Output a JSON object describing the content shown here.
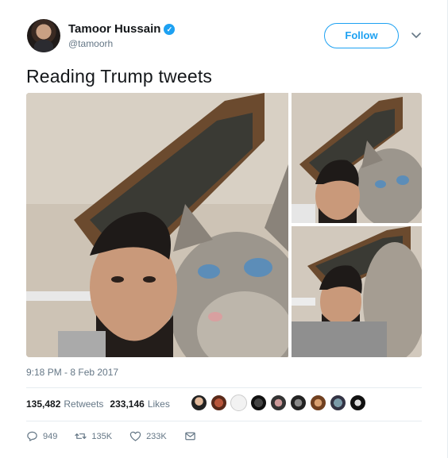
{
  "author": {
    "name": "Tamoor Hussain",
    "handle": "@tamoorh",
    "verified_mark": "✓"
  },
  "follow_label": "Follow",
  "tweet_text": "Reading Trump tweets",
  "timestamp": "9:18 PM - 8 Feb 2017",
  "stats": {
    "retweets_count": "135,482",
    "retweets_label": "Retweets",
    "likes_count": "233,146",
    "likes_label": "Likes"
  },
  "actions": {
    "replies": "949",
    "retweets": "135K",
    "likes": "233K"
  },
  "colors": {
    "accent": "#1da1f2",
    "text": "#14171a",
    "muted": "#657786"
  },
  "icons": [
    "verified-badge-icon",
    "chevron-down-icon",
    "reply-icon",
    "retweet-icon",
    "like-icon",
    "direct-message-icon"
  ]
}
